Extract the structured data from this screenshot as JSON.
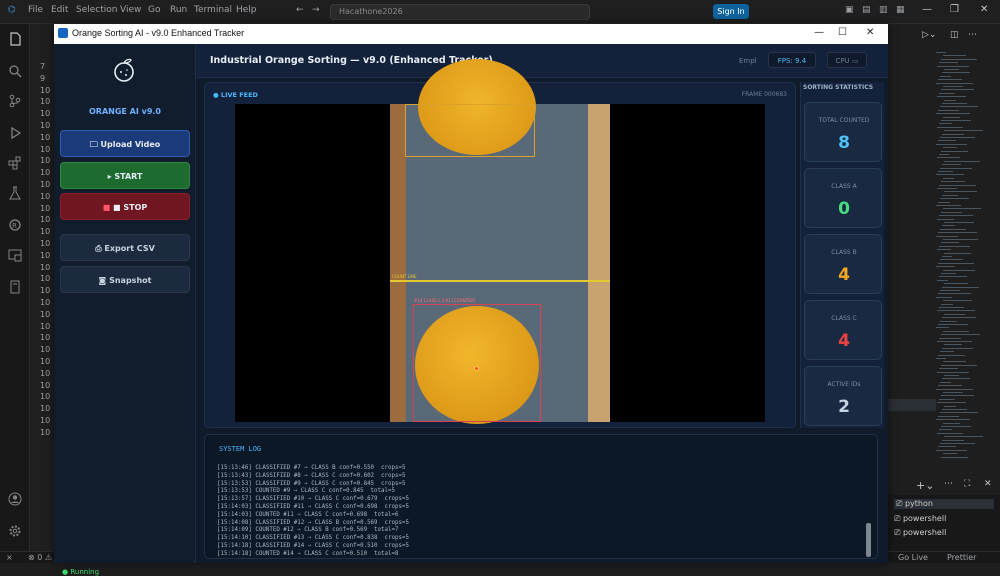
{
  "vscode": {
    "menu": [
      "File",
      "Edit",
      "Selection",
      "View",
      "Go",
      "Run",
      "Terminal",
      "Help"
    ],
    "search_text": "Hacathone2026",
    "sign_in": "Sign In",
    "line_numbers": [
      "7",
      "9",
      "10",
      "10",
      "10",
      "10",
      "10",
      "10",
      "10",
      "10",
      "10",
      "10",
      "10",
      "10",
      "10",
      "10",
      "10",
      "10",
      "10",
      "10",
      "10",
      "10",
      "10",
      "10",
      "10",
      "10",
      "10",
      "10",
      "10",
      "10",
      "10",
      "10"
    ],
    "terminals": [
      "python",
      "powershell",
      "powershell"
    ],
    "statusbar_left": "⊗ 0 ⚠ 0",
    "statusbar_golive": "Go Live",
    "statusbar_prettier": "Prettier"
  },
  "app": {
    "window_title": "Orange Sorting AI - v9.0 Enhanced Tracker",
    "brand_name": "ORANGE AI v9.0",
    "buttons": {
      "upload": "Upload Video",
      "start": "▸ START",
      "stop": "■ STOP",
      "export": "Export CSV",
      "snapshot": "Snapshot"
    },
    "status": "Running",
    "header_title": "Industrial Orange Sorting — v9.0 (Enhanced Tracker)",
    "header_empl": "Empl",
    "fps": "FPS: 9.4",
    "cpu": "CPU",
    "live_feed_label": "● LIVE FEED",
    "frame_label": "FRAME 000683",
    "count_line_label": "COUNT LINE",
    "detection_label": "#14 CLASS C 0.91 [COUNTED]",
    "stats_title": "SORTING STATISTICS",
    "stats": [
      {
        "label": "TOTAL COUNTED",
        "value": "8",
        "color": "#4fc3f7"
      },
      {
        "label": "CLASS A",
        "value": "0",
        "color": "#4ade80"
      },
      {
        "label": "CLASS B",
        "value": "4",
        "color": "#f5a623"
      },
      {
        "label": "CLASS C",
        "value": "4",
        "color": "#ef4444"
      },
      {
        "label": "ACTIVE IDs",
        "value": "2",
        "color": "#c5d2e0"
      }
    ],
    "log_title": "SYSTEM LOG",
    "log_lines": [
      "[15:13:46] CLASSIFIED #7 → CLASS B conf=0.550  crops=5",
      "[15:13:43] CLASSIFIED #8 → CLASS C conf=0.602  crops=5",
      "[15:13:53] CLASSIFIED #9 → CLASS C conf=0.845  crops=5",
      "[15:13:53] COUNTED #9 → CLASS C conf=0.845  total=5",
      "[15:13:57] CLASSIFIED #10 → CLASS C conf=0.679  crops=5",
      "[15:14:03] CLASSIFIED #11 → CLASS C conf=0.698  crops=5",
      "[15:14:03] COUNTED #11 → CLASS C conf=0.698  total=6",
      "[15:14:08] CLASSIFIED #12 → CLASS B conf=0.569  crops=5",
      "[15:14:09] COUNTED #12 → CLASS B conf=0.569  total=7",
      "[15:14:10] CLASSIFIED #13 → CLASS C conf=0.838  crops=5",
      "[15:14:18] CLASSIFIED #14 → CLASS C conf=0.510  crops=5",
      "[15:14:18] COUNTED #14 → CLASS C conf=0.510  total=8"
    ]
  }
}
